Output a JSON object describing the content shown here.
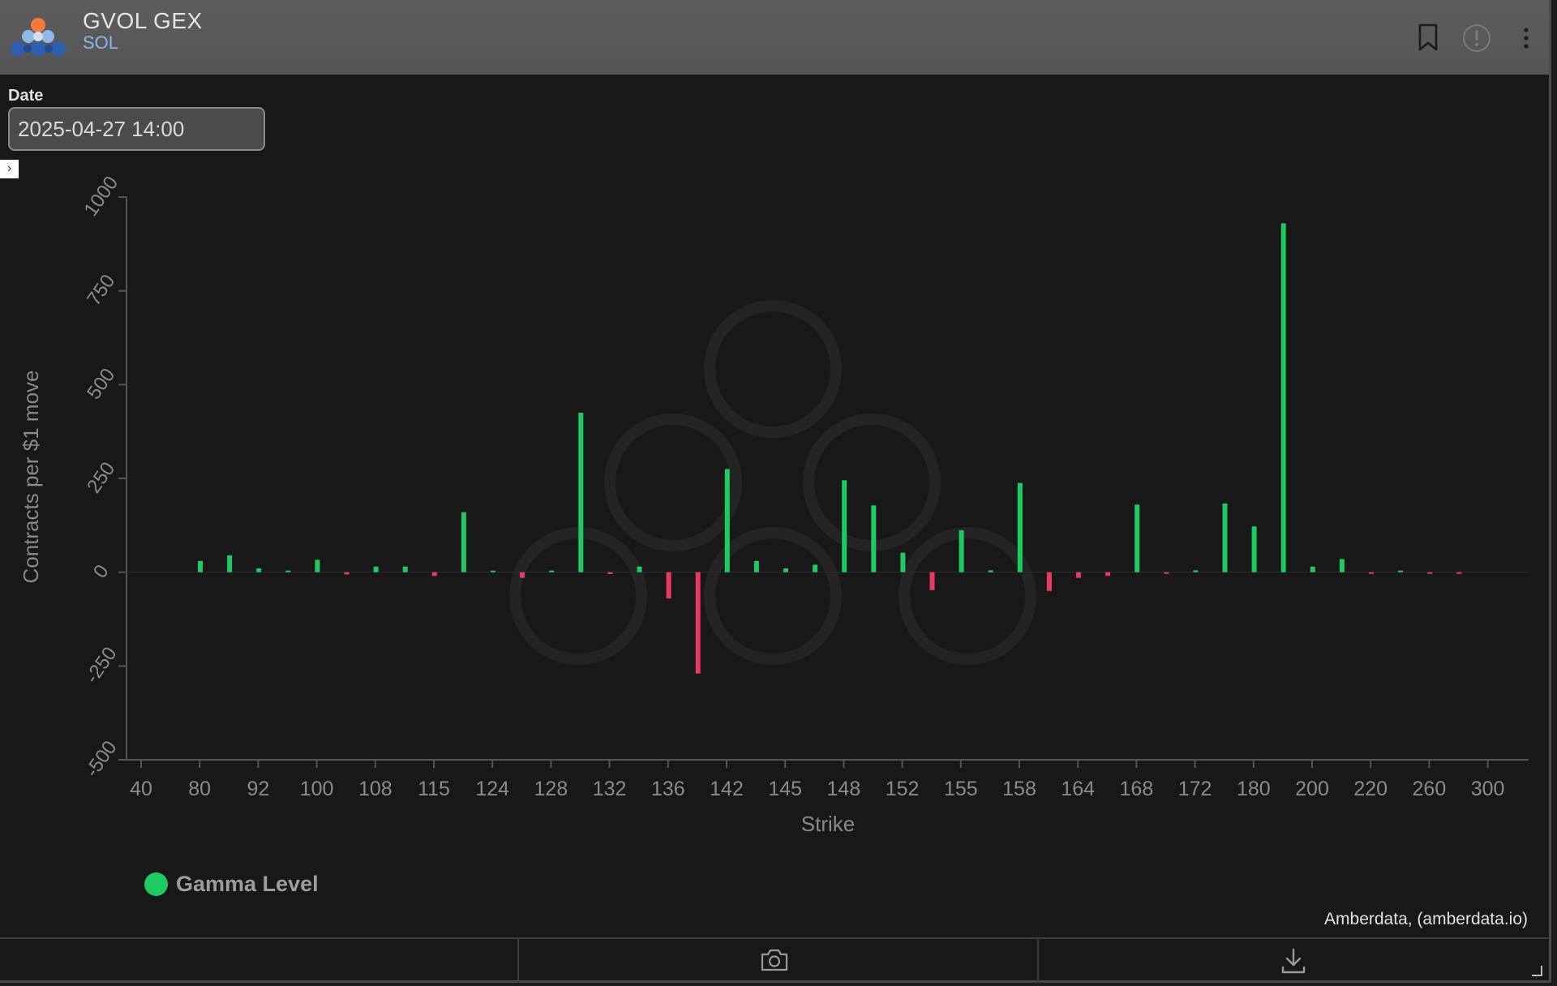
{
  "header": {
    "title": "GVOL GEX",
    "subtitle": "SOL",
    "icons": [
      "bookmark-icon",
      "info-icon",
      "more-vertical-icon"
    ]
  },
  "controls": {
    "date_label": "Date",
    "date_value": "2025-04-27 14:00"
  },
  "colors": {
    "positive": "#1ecb63",
    "negative": "#e8395f",
    "axis": "#555555",
    "tick_text": "#8a8a8a",
    "header_bg": "#595959",
    "panel_bg": "#181818"
  },
  "chart_data": {
    "type": "bar",
    "title": "",
    "xlabel": "Strike",
    "ylabel": "Contracts per $1 move",
    "ylim": [
      -500,
      1000
    ],
    "yticks": [
      -500,
      -250,
      0,
      250,
      500,
      750,
      1000
    ],
    "tick_labels": [
      "40",
      "80",
      "92",
      "100",
      "108",
      "115",
      "124",
      "128",
      "132",
      "136",
      "142",
      "145",
      "148",
      "152",
      "155",
      "158",
      "164",
      "168",
      "172",
      "180",
      "200",
      "220",
      "260",
      "300"
    ],
    "grid": false,
    "legend": {
      "position": "bottom-left"
    },
    "series": [
      {
        "name": "Gamma Level",
        "values": [
          30,
          45,
          10,
          4,
          33,
          -6,
          15,
          15,
          -10,
          160,
          4,
          -15,
          4,
          425,
          -5,
          15,
          -70,
          -270,
          275,
          30,
          10,
          20,
          245,
          178,
          52,
          -48,
          112,
          5,
          238,
          -50,
          -15,
          -10,
          180,
          -4,
          5,
          183,
          122,
          930,
          15,
          35,
          -4,
          4,
          -4,
          -4
        ]
      }
    ]
  },
  "credit": "Amberdata, (amberdata.io)",
  "footer": {
    "buttons": [
      "camera-icon",
      "download-icon"
    ]
  }
}
